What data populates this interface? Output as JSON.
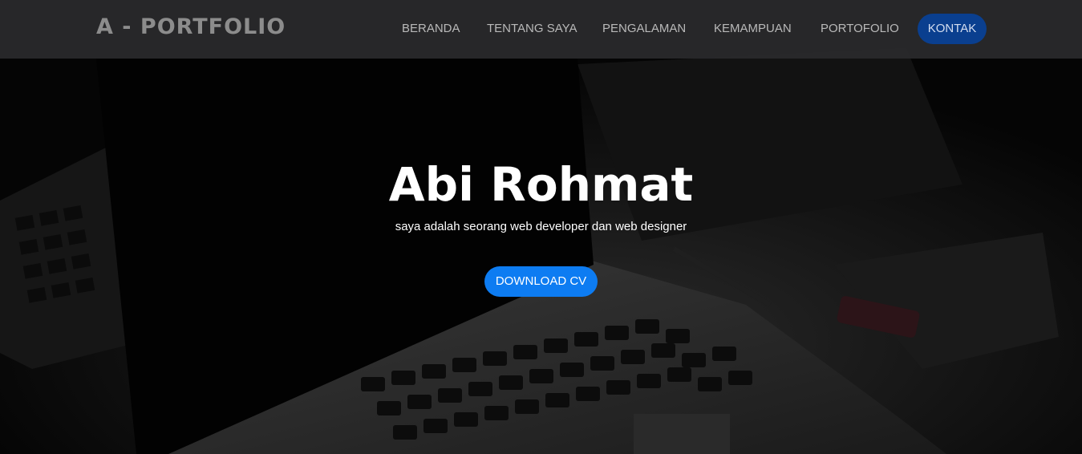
{
  "brand": {
    "name": "A - PORTFOLIO"
  },
  "nav": {
    "items": [
      {
        "label": "BERANDA"
      },
      {
        "label": "TENTANG SAYA"
      },
      {
        "label": "PENGALAMAN"
      },
      {
        "label": "KEMAMPUAN"
      },
      {
        "label": "PORTOFOLIO"
      },
      {
        "label": "KONTAK"
      }
    ]
  },
  "hero": {
    "title": "Abi Rohmat",
    "subtitle": "saya adalah seorang web developer dan web designer",
    "cta_label": "DOWNLOAD CV"
  },
  "colors": {
    "navbar_bg": "#2a2a2c",
    "nav_text": "#b9b9b9",
    "active_pill": "#0a3f8f",
    "cta": "#0d7cf2",
    "hero_text": "#ffffff"
  }
}
